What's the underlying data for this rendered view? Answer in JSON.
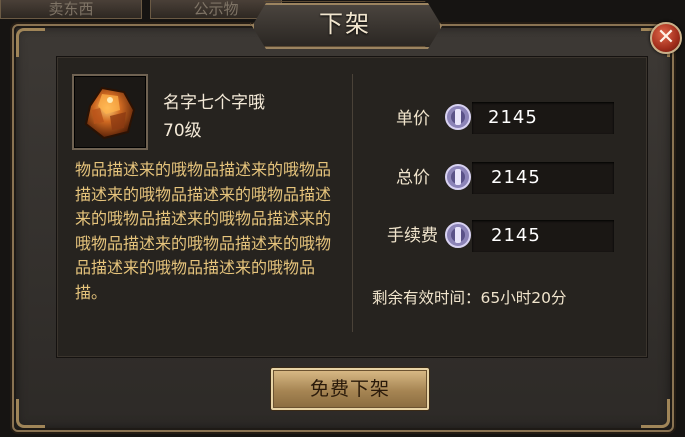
{
  "background_tabs": [
    "卖东西",
    "公示物"
  ],
  "dialog": {
    "title": "下架",
    "close_icon": "close-icon"
  },
  "item": {
    "icon": "ore-icon",
    "name": "名字七个字哦",
    "level": "70级",
    "description": "物品描述来的哦物品描述来的哦物品描述来的哦物品描述来的哦物品描述来的哦物品描述来的哦物品描述来的哦物品描述来的哦物品描述来的哦物品描述来的哦物品描述来的哦物品描。"
  },
  "prices": [
    {
      "label": "单价",
      "value": "2145",
      "icon": "silver-coin-icon"
    },
    {
      "label": "总价",
      "value": "2145",
      "icon": "silver-coin-icon"
    },
    {
      "label": "手续费",
      "value": "2145",
      "icon": "silver-coin-icon"
    }
  ],
  "remaining_time": "剩余有效时间：65小时20分",
  "button": {
    "label": "免费下架"
  },
  "colors": {
    "frame_gold": "#8a7352",
    "description_text": "#e6c47c",
    "button_gold": "#d9ba86",
    "close_red": "#a12d1b"
  }
}
